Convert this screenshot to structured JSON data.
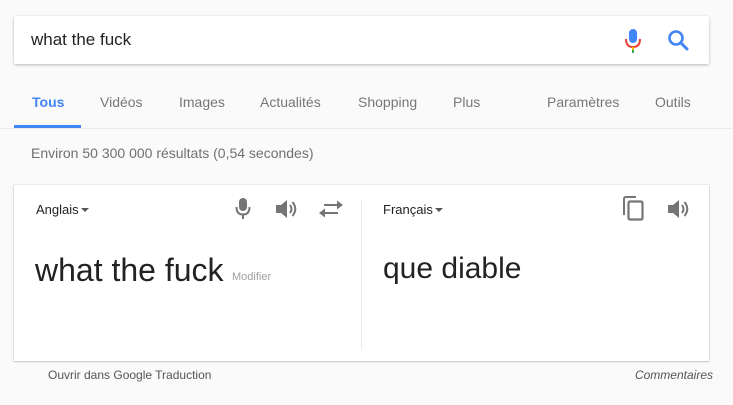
{
  "search": {
    "query": "what the fuck"
  },
  "tabs": [
    {
      "label": "Tous",
      "active": true
    },
    {
      "label": "Vidéos"
    },
    {
      "label": "Images"
    },
    {
      "label": "Actualités"
    },
    {
      "label": "Shopping"
    },
    {
      "label": "Plus"
    },
    {
      "label": "Paramètres"
    },
    {
      "label": "Outils"
    }
  ],
  "result_stats": "Environ 50 300 000 résultats (0,54 secondes)",
  "translate": {
    "source_language": "Anglais",
    "target_language": "Français",
    "source_text": "what the fuck",
    "modify_label": "Modifier",
    "target_text": "que diable"
  },
  "footer": {
    "open_translate": "Ouvrir dans Google Traduction",
    "feedback": "Commentaires"
  },
  "icons": {
    "mic": "microphone-icon",
    "search": "search-icon",
    "speaker": "speaker-icon",
    "swap": "swap-icon",
    "copy": "copy-icon"
  },
  "colors": {
    "accent": "#4285f4",
    "mic_red": "#ea4335",
    "mic_yellow": "#fbbc05",
    "mic_green": "#34a853"
  }
}
